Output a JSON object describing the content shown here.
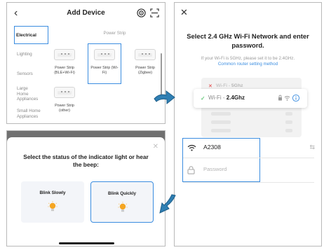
{
  "add_device": {
    "title": "Add Device",
    "categories": [
      "Electrical",
      "Lighting",
      "Sensors",
      "Large Home Appliances",
      "Small Home Appliances"
    ],
    "section_title": "Power Strip",
    "devices": [
      {
        "label": "Power Strip (BLE+Wi-Fi)"
      },
      {
        "label": "Power Strip (Wi-Fi)"
      },
      {
        "label": "Power Strip (Zigbee)"
      },
      {
        "label": "Power Strip (other)"
      }
    ]
  },
  "indicator": {
    "title": "Select the status of the indicator light or hear the beep:",
    "options": [
      {
        "label": "Blink Slowly"
      },
      {
        "label": "Blink Quickly"
      }
    ]
  },
  "wifi": {
    "title": "Select 2.4 GHz Wi-Fi Network and enter password.",
    "note": "If your Wi-Fi is 5GHz, please set it to be 2.4GHz.",
    "link": "Common router setting method",
    "networks": [
      {
        "prefix": "Wi-Fi - ",
        "band": "5Ghz"
      },
      {
        "prefix": "Wi-Fi - ",
        "band": "2.4Ghz"
      }
    ],
    "ssid_value": "A2308",
    "password_placeholder": "Password"
  },
  "colors": {
    "accent": "#3b8de0",
    "check": "#2eb54a",
    "error": "#e23b3b",
    "arrow": "#2f7fb3"
  }
}
